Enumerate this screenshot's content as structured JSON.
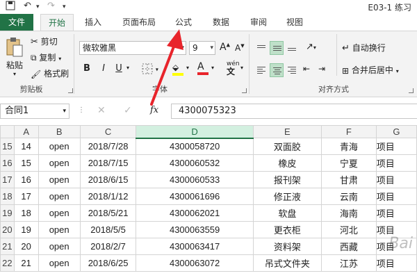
{
  "titlebar": {
    "title": "E03-1  练习"
  },
  "tabs": [
    {
      "label": "文件"
    },
    {
      "label": "开始"
    },
    {
      "label": "插入"
    },
    {
      "label": "页面布局"
    },
    {
      "label": "公式"
    },
    {
      "label": "数据"
    },
    {
      "label": "审阅"
    },
    {
      "label": "视图"
    }
  ],
  "ribbon": {
    "clipboard": {
      "paste": "粘贴",
      "cut": "剪切",
      "copy": "复制",
      "format_painter": "格式刷",
      "label": "剪贴板"
    },
    "font": {
      "name": "微软雅黑",
      "size": "9",
      "increase": "A",
      "decrease": "A",
      "bold": "B",
      "italic": "I",
      "underline": "U",
      "font_color_glyph": "A",
      "phonetic": "wén",
      "label": "字体"
    },
    "alignment": {
      "wrap_text": "自动换行",
      "merge_center": "合并后居中",
      "label": "对齐方式"
    }
  },
  "formula_bar": {
    "name_box": "合同1",
    "fx": "fx",
    "value": "4300075323"
  },
  "columns": [
    "A",
    "B",
    "C",
    "D",
    "E",
    "F",
    "G"
  ],
  "rows": [
    {
      "num": "15",
      "a": "14",
      "b": "open",
      "c": "2018/7/28",
      "d": "4300058720",
      "e": "双面胶",
      "f": "青海",
      "g": "项目"
    },
    {
      "num": "16",
      "a": "15",
      "b": "open",
      "c": "2018/7/15",
      "d": "4300060532",
      "e": "橡皮",
      "f": "宁夏",
      "g": "项目"
    },
    {
      "num": "17",
      "a": "16",
      "b": "open",
      "c": "2018/6/15",
      "d": "4300060533",
      "e": "报刊架",
      "f": "甘肃",
      "g": "项目"
    },
    {
      "num": "18",
      "a": "17",
      "b": "open",
      "c": "2018/1/12",
      "d": "4300061696",
      "e": "修正液",
      "f": "云南",
      "g": "项目"
    },
    {
      "num": "19",
      "a": "18",
      "b": "open",
      "c": "2018/5/21",
      "d": "4300062021",
      "e": "软盘",
      "f": "海南",
      "g": "项目"
    },
    {
      "num": "20",
      "a": "19",
      "b": "open",
      "c": "2018/5/5",
      "d": "4300063559",
      "e": "更衣柜",
      "f": "河北",
      "g": "项目"
    },
    {
      "num": "21",
      "a": "20",
      "b": "open",
      "c": "2018/2/7",
      "d": "4300063417",
      "e": "资料架",
      "f": "西藏",
      "g": "项目"
    },
    {
      "num": "22",
      "a": "21",
      "b": "open",
      "c": "2018/6/25",
      "d": "4300063072",
      "e": "吊式文件夹",
      "f": "江苏",
      "g": "项目"
    }
  ],
  "colors": {
    "accent": "#217346",
    "arrow": "#e8242b"
  },
  "watermark": "Bai"
}
